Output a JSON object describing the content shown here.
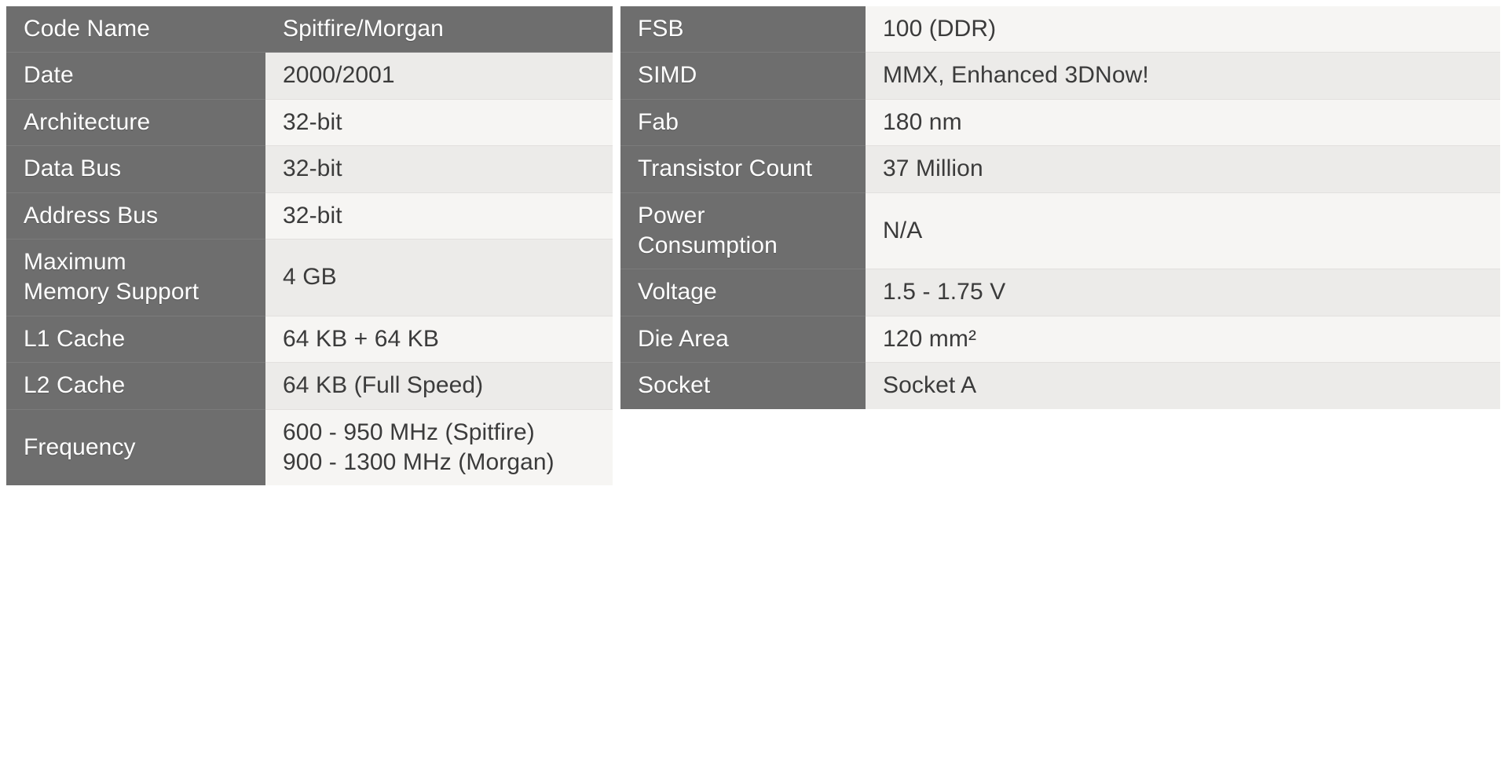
{
  "theme": {
    "page_background": "#ffffff",
    "label_cell_background": "#6e6e6e",
    "label_text_color": "#ffffff",
    "value_row_odd_background": "#f6f5f3",
    "value_row_even_background": "#ecebe9",
    "value_text_color": "#3b3b3b",
    "row_divider_color": "#e2e0de"
  },
  "tables": [
    {
      "name": "cpu-spec-table-left",
      "rows": [
        {
          "label": "Code Name",
          "value": "Spitfire/Morgan",
          "style": "full-dark"
        },
        {
          "label": "Date",
          "value": "2000/2001"
        },
        {
          "label": "Architecture",
          "value": "32-bit"
        },
        {
          "label": "Data Bus",
          "value": "32-bit"
        },
        {
          "label": "Address Bus",
          "value": "32-bit"
        },
        {
          "label": "Maximum\nMemory Support",
          "value": "4 GB"
        },
        {
          "label": "L1 Cache",
          "value": "64 KB + 64 KB"
        },
        {
          "label": "L2 Cache",
          "value": "64 KB (Full Speed)"
        },
        {
          "label": "Frequency",
          "value": "600 - 950 MHz (Spitfire)\n900 - 1300 MHz (Morgan)"
        }
      ]
    },
    {
      "name": "cpu-spec-table-right",
      "rows": [
        {
          "label": "FSB",
          "value": "100 (DDR)"
        },
        {
          "label": "SIMD",
          "value": "MMX, Enhanced 3DNow!"
        },
        {
          "label": "Fab",
          "value": "180 nm"
        },
        {
          "label": "Transistor Count",
          "value": "37 Million"
        },
        {
          "label": "Power\nConsumption",
          "value": "N/A"
        },
        {
          "label": "Voltage",
          "value": "1.5 - 1.75 V"
        },
        {
          "label": "Die Area",
          "value": "120 mm²"
        },
        {
          "label": "Socket",
          "value": "Socket A"
        }
      ]
    }
  ]
}
